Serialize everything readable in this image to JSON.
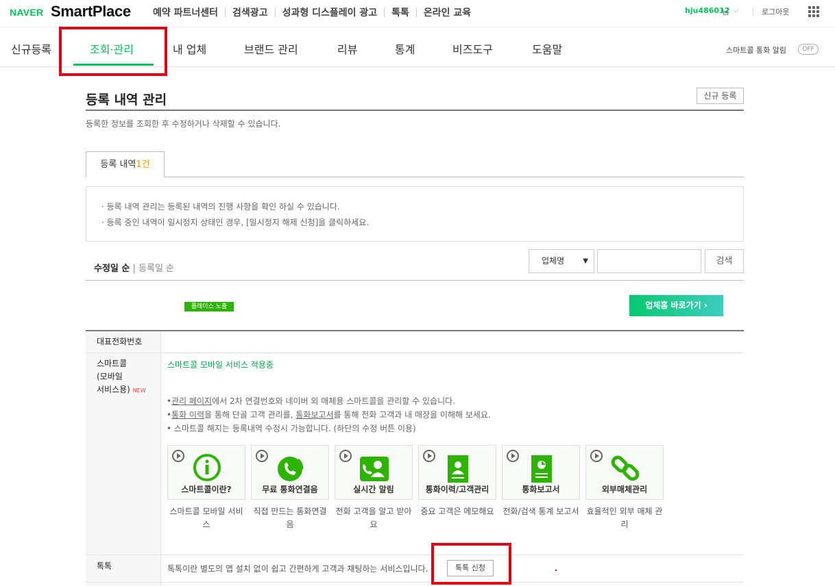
{
  "logo": {
    "naver": "NAVER",
    "smartplace": "SmartPlace"
  },
  "topnav": [
    "예약 파트너센터",
    "검색광고",
    "성과형 디스플레이 광고",
    "톡톡",
    "온라인 교육"
  ],
  "user": {
    "id": "hju486012",
    "suffix": "님",
    "logout": "로그아웃"
  },
  "mainnav": [
    "신규등록",
    "조회·관리",
    "내 업체",
    "브랜드 관리",
    "리뷰",
    "통계",
    "비즈도구",
    "도움말"
  ],
  "notify": {
    "label": "스마트콜 통화 알림",
    "toggle": "OFF"
  },
  "page": {
    "title": "등록 내역 관리",
    "desc": "등록한 정보를 조회한 후 수정하거나 삭제할 수 있습니다.",
    "new_button": "신규 등록"
  },
  "tab": {
    "label": "등록 내역",
    "count": "1건"
  },
  "info": [
    "·  등록 내역 관리는 등록된 내역의 진행 사항을 확인 하실 수 있습니다.",
    "·  등록 중인 내역이 일시정지 상태인 경우, [일시정지 해제 신청]을 클릭하세요."
  ],
  "sort": {
    "active": "수정일 순",
    "sep": " | ",
    "other": "등록일 순"
  },
  "search": {
    "select": "업체명",
    "value": "",
    "button": "검색"
  },
  "listing": {
    "badge": "플레이스 노출",
    "home_button": "업체홈 바로가기 ›"
  },
  "table": {
    "rep_phone_label": "대표전화번호",
    "smartcall_label_lines": [
      "스마트콜",
      "(모바일",
      "서비스용)"
    ],
    "new_tag": "NEW",
    "smartcall_status": "스마트콜 모바일 서비스 적용중",
    "smartcall_bullets": [
      {
        "pre": "•",
        "u1": "관리 페이지",
        "mid": "에서 2차 연결번호와 네이버 외 매체용 스마트콜을 관리할 수 있습니다.",
        "u2": "",
        "post": ""
      },
      {
        "pre": "•",
        "u1": "통화 이력",
        "mid": "을 통해 단골 고객 관리를, ",
        "u2": "통화보고서",
        "post": "를 통해 전화 고객과 내 매장을 이해해 보세요."
      },
      {
        "pre": "• ",
        "u1": "",
        "mid": "스마트콜 해지는 등록내역 수정시 가능합니다. (하단의 수정 버튼 이용)",
        "u2": "",
        "post": ""
      }
    ],
    "cards": [
      {
        "caption": "스마트콜이란?",
        "desc": "스마트콜 모바일 서비스",
        "icon": "info-icon"
      },
      {
        "caption": "무료 통화연결음",
        "desc": "직접 만드는 통화연결음",
        "icon": "phone-ring-icon"
      },
      {
        "caption": "실시간 알림",
        "desc": "전화 고객을 알고 받아요",
        "icon": "user-call-icon"
      },
      {
        "caption": "통화이력/고객관리",
        "desc": "중요 고객은 메모해요",
        "icon": "contact-card-icon"
      },
      {
        "caption": "통화보고서",
        "desc": "전화/검색 통계 보고서",
        "icon": "report-icon"
      },
      {
        "caption": "외부매체관리",
        "desc": "효율적인 외부 매체 관리",
        "icon": "link-icon"
      }
    ],
    "talktalk_label": "톡톡",
    "talktalk_text": "톡톡이란 별도의 앱 설치 없이 쉽고 간편하게 고객과 채팅하는 서비스입니다.",
    "talktalk_button": "톡톡 신청"
  },
  "colors": {
    "brand": "#03c75a",
    "annotation": "#e60012",
    "count": "#f39c12"
  }
}
